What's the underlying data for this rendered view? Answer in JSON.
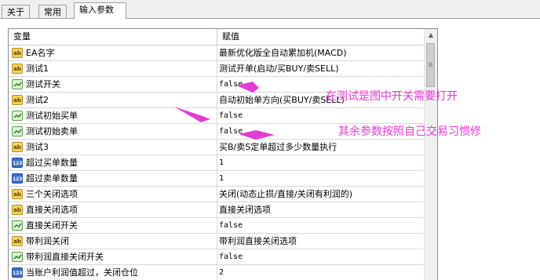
{
  "tabs": [
    {
      "label": "关于",
      "active": false
    },
    {
      "label": "常用",
      "active": false
    },
    {
      "label": "输入参数",
      "active": true
    }
  ],
  "grid": {
    "header": {
      "name": "变量",
      "value": "赋值"
    },
    "rows": [
      {
        "icon": "ab",
        "name": "EA名字",
        "value": "最新优化版全自动累加机(MACD)"
      },
      {
        "icon": "ab",
        "name": "测试1",
        "value": "测试开单(启动/买BUY/卖SELL)"
      },
      {
        "icon": "bool",
        "name": "测试开关",
        "value": "false"
      },
      {
        "icon": "ab",
        "name": "测试2",
        "value": "自动初始单方向(买BUY/卖SELL)"
      },
      {
        "icon": "bool",
        "name": "测试初始买单",
        "value": "false"
      },
      {
        "icon": "bool",
        "name": "测试初始卖单",
        "value": "false"
      },
      {
        "icon": "ab",
        "name": "测试3",
        "value": "买B/卖S定单超过多少数量执行"
      },
      {
        "icon": "num",
        "name": "超过买单数量",
        "value": "1"
      },
      {
        "icon": "num",
        "name": "超过卖单数量",
        "value": "1"
      },
      {
        "icon": "ab",
        "name": "三个关闭选项",
        "value": "关闭(动态止损/直接/关闭有利润的)"
      },
      {
        "icon": "ab",
        "name": "直接关闭选项",
        "value": "直接关闭选项"
      },
      {
        "icon": "bool",
        "name": "直接关闭开关",
        "value": "false"
      },
      {
        "icon": "ab",
        "name": "带利润关闭",
        "value": "带利润直接关闭选项"
      },
      {
        "icon": "bool",
        "name": "带利润直接关闭开关",
        "value": "false"
      },
      {
        "icon": "num",
        "name": "当账户利润值超过，关闭仓位",
        "value": "2"
      }
    ]
  },
  "annotations": {
    "note1": "在测试是图中开关需要打开",
    "note2": "其余参数按照自己交易习惯修",
    "color": "#e33cd2"
  },
  "icon_labels": {
    "ab": "ab",
    "num": "123"
  }
}
